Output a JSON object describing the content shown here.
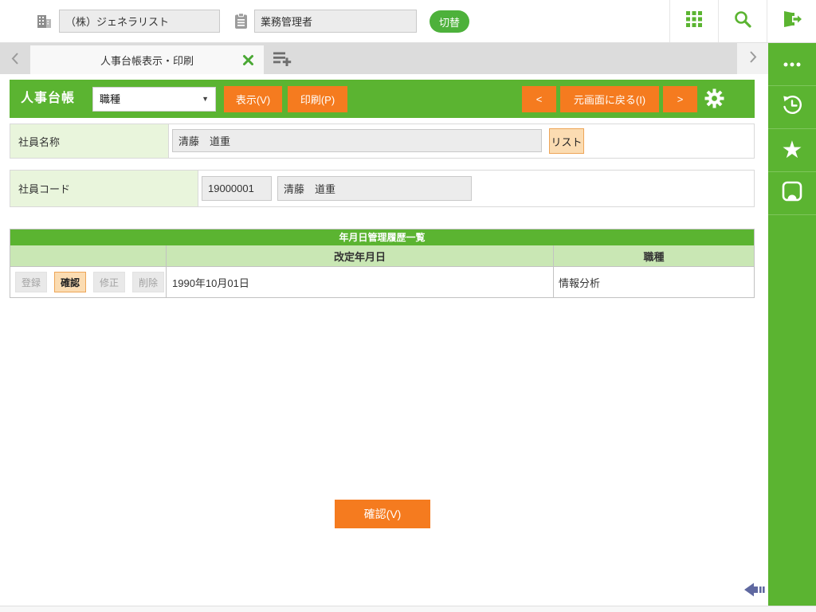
{
  "topbar": {
    "company_value": "（株）ジェネラリスト",
    "role_value": "業務管理者",
    "switch_label": "切替"
  },
  "tabbar": {
    "active_tab_title": "人事台帳表示・印刷"
  },
  "toolbar": {
    "app_title": "人事台帳",
    "select_value": "職種",
    "show_button": "表示(V)",
    "print_button": "印刷(P)",
    "prev_button": "<",
    "back_button": "元画面に戻る(I)",
    "next_button": ">"
  },
  "form": {
    "employee_name_label": "社員名称",
    "employee_name_value": "清藤　道重",
    "list_button": "リスト",
    "employee_code_label": "社員コード",
    "employee_code_value": "19000001",
    "employee_code_name": "清藤　道重"
  },
  "history": {
    "title": "年月日管理履歴一覧",
    "col_date": "改定年月日",
    "col_jobtype": "職種",
    "row": {
      "action_register": "登録",
      "action_confirm": "確認",
      "action_modify": "修正",
      "action_delete": "削除",
      "date": "1990年10月01日",
      "jobtype": "情報分析"
    }
  },
  "footer": {
    "confirm_button": "確認(V)"
  },
  "colors": {
    "green": "#5bb431",
    "orange": "#f57b1f",
    "peach": "#fbdcb2",
    "peach_border": "#eda558",
    "indigo": "#5f68a0"
  }
}
